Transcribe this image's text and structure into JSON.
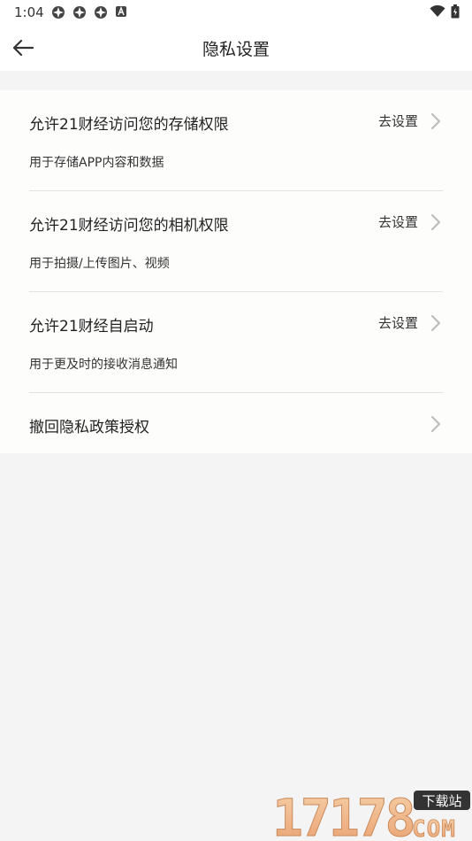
{
  "status_bar": {
    "time": "1:04"
  },
  "header": {
    "title": "隐私设置"
  },
  "settings": [
    {
      "title": "允许21财经访问您的存储权限",
      "desc": "用于存储APP内容和数据",
      "action": "去设置"
    },
    {
      "title": "允许21财经访问您的相机权限",
      "desc": "用于拍摄/上传图片、视频",
      "action": "去设置"
    },
    {
      "title": "允许21财经自启动",
      "desc": "用于更及时的接收消息通知",
      "action": "去设置"
    }
  ],
  "revoke": {
    "title": "撤回隐私政策授权"
  },
  "watermark": {
    "digits": "17178",
    "badge": "下载站",
    "suffix": "COM"
  },
  "colors": {
    "background": "#f4f4f4",
    "card": "#fdfdfc",
    "divider": "#e2e2e2",
    "chevron": "#bdbdbd"
  }
}
